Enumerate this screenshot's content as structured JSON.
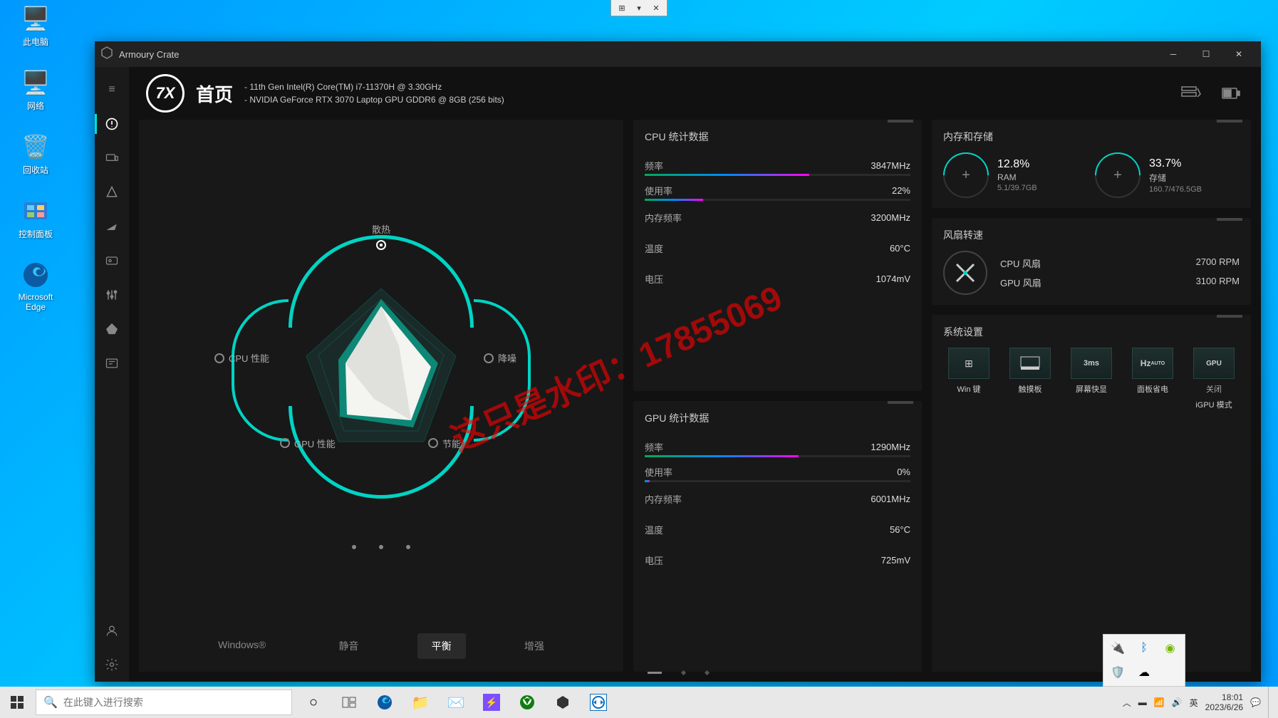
{
  "desktop": {
    "icons": [
      {
        "label": "此电脑",
        "glyph": "🖥️"
      },
      {
        "label": "网络",
        "glyph": "🖥️"
      },
      {
        "label": "回收站",
        "glyph": "🗑️"
      },
      {
        "label": "控制面板",
        "glyph": "⚙️"
      },
      {
        "label": "Microsoft Edge",
        "glyph": "🌐"
      }
    ]
  },
  "app": {
    "title": "Armoury Crate",
    "pageTitle": "首页",
    "specs": {
      "cpu": "11th Gen Intel(R) Core(TM) i7-11370H @ 3.30GHz",
      "gpu": "NVIDIA GeForce RTX 3070 Laptop GPU GDDR6 @ 8GB (256 bits)"
    },
    "radar": {
      "labels": {
        "top": "散热",
        "left": "CPU 性能",
        "right": "降噪",
        "bleft": "GPU 性能",
        "bright": "节能"
      }
    },
    "modes": {
      "windows": "Windows®",
      "silent": "静音",
      "balanced": "平衡",
      "turbo": "增强",
      "active": "balanced"
    },
    "cpuPanel": {
      "title": "CPU 统计数据",
      "freq": {
        "label": "频率",
        "value": "3847MHz",
        "pct": 62
      },
      "usage": {
        "label": "使用率",
        "value": "22%",
        "pct": 22
      },
      "memfreq": {
        "label": "内存频率",
        "value": "3200MHz"
      },
      "temp": {
        "label": "温度",
        "value": "60°C"
      },
      "volt": {
        "label": "电压",
        "value": "1074mV"
      }
    },
    "gpuPanel": {
      "title": "GPU 统计数据",
      "freq": {
        "label": "频率",
        "value": "1290MHz",
        "pct": 58
      },
      "usage": {
        "label": "使用率",
        "value": "0%",
        "pct": 0
      },
      "memfreq": {
        "label": "内存频率",
        "value": "6001MHz"
      },
      "temp": {
        "label": "温度",
        "value": "56°C"
      },
      "volt": {
        "label": "电压",
        "value": "725mV"
      }
    },
    "memPanel": {
      "title": "内存和存储",
      "ram": {
        "pct": "12.8%",
        "label": "RAM",
        "detail": "5.1/39.7GB"
      },
      "storage": {
        "pct": "33.7%",
        "label": "存储",
        "detail": "160.7/476.5GB"
      }
    },
    "fanPanel": {
      "title": "风扇转速",
      "cpu": {
        "label": "CPU 风扇",
        "value": "2700 RPM"
      },
      "gpu": {
        "label": "GPU 风扇",
        "value": "3100 RPM"
      }
    },
    "sysPanel": {
      "title": "系统设置",
      "items": [
        {
          "label": "Win 键",
          "icon": "⊞"
        },
        {
          "label": "触摸板",
          "icon": "▭"
        },
        {
          "label": "屏幕快显",
          "icon": "3ms"
        },
        {
          "label": "面板省电",
          "icon": "Hz"
        },
        {
          "label": "iGPU 模式",
          "icon": "GPU",
          "sub": "关闭"
        }
      ]
    }
  },
  "watermark": "这只是水印：17855069",
  "taskbar": {
    "searchPlaceholder": "在此键入进行搜索",
    "ime": "英",
    "time": "18:01",
    "date": "2023/6/26"
  }
}
